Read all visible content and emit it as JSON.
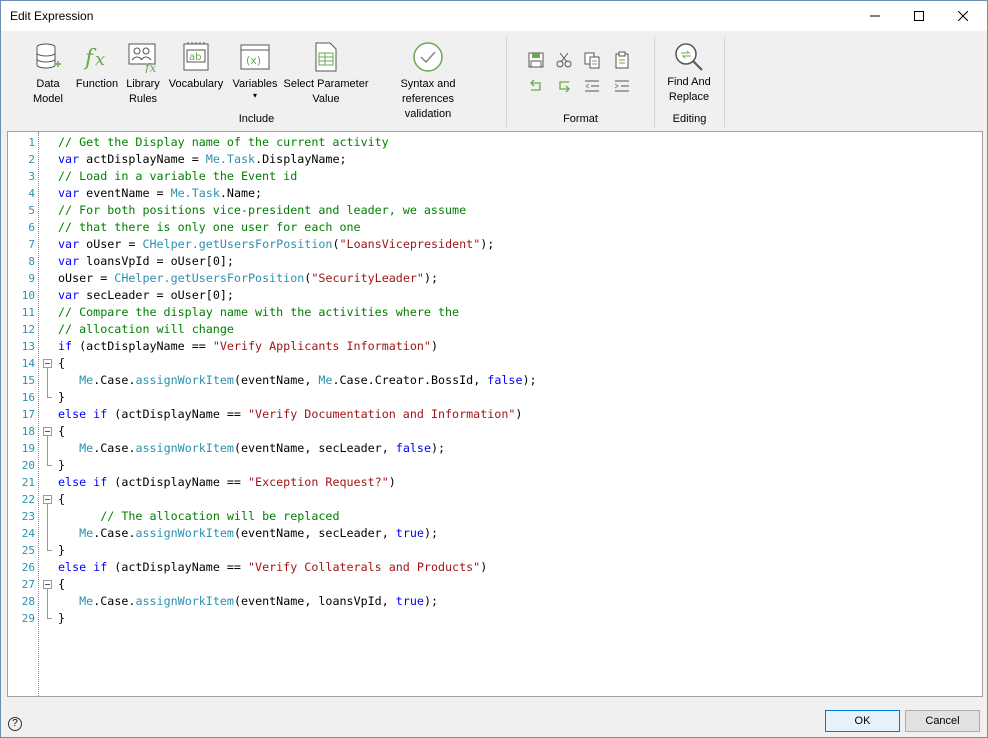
{
  "window": {
    "title": "Edit Expression",
    "controls": [
      "minimize",
      "maximize",
      "close"
    ]
  },
  "ribbon": {
    "include_group": {
      "label": "Include",
      "buttons": [
        {
          "id": "data-model",
          "label": "Data\nModel",
          "icon": "database-add-icon"
        },
        {
          "id": "function",
          "label": "Function",
          "icon": "fx-icon"
        },
        {
          "id": "library-rules",
          "label": "Library\nRules",
          "icon": "people-fx-icon"
        },
        {
          "id": "vocabulary",
          "label": "Vocabulary",
          "icon": "ab-notebook-icon"
        },
        {
          "id": "variables",
          "label": "Variables",
          "icon": "variable-x-icon"
        },
        {
          "id": "select-parameter-value",
          "label": "Select Parameter\nValue",
          "icon": "table-doc-icon"
        },
        {
          "id": "syntax-validation",
          "label": "Syntax and references\nvalidation",
          "icon": "check-circle-icon"
        }
      ]
    },
    "format_group": {
      "label": "Format",
      "icons": [
        "save-icon",
        "cut-icon",
        "copy-icon",
        "paste-icon",
        "undo-icon",
        "redo-icon",
        "outdent-icon",
        "indent-icon"
      ]
    },
    "editing_group": {
      "label": "Editing",
      "buttons": [
        {
          "id": "find-replace",
          "label": "Find And\nReplace",
          "icon": "magnifier-replace-icon"
        }
      ]
    }
  },
  "editor": {
    "lines": [
      [
        [
          "com",
          "// Get the Display name of the current activity"
        ]
      ],
      [
        [
          "kw",
          "var"
        ],
        [
          "pl",
          " actDisplayName = "
        ],
        [
          "obj",
          "Me.Task"
        ],
        [
          "pl",
          ".DisplayName;"
        ]
      ],
      [
        [
          "com",
          "// Load in a variable the Event id"
        ]
      ],
      [
        [
          "kw",
          "var"
        ],
        [
          "pl",
          " eventName = "
        ],
        [
          "obj",
          "Me.Task"
        ],
        [
          "pl",
          ".Name;"
        ]
      ],
      [
        [
          "com",
          "// For both positions vice-president and leader, we assume"
        ]
      ],
      [
        [
          "com",
          "// that there is only one user for each one"
        ]
      ],
      [
        [
          "kw",
          "var"
        ],
        [
          "pl",
          " oUser = "
        ],
        [
          "obj",
          "CHelper.getUsersForPosition"
        ],
        [
          "pl",
          "("
        ],
        [
          "str",
          "\"LoansVicepresident\""
        ],
        [
          "pl",
          ");"
        ]
      ],
      [
        [
          "kw",
          "var"
        ],
        [
          "pl",
          " loansVpId = oUser["
        ],
        [
          "num",
          "0"
        ],
        [
          "pl",
          "];"
        ]
      ],
      [
        [
          "pl",
          "oUser = "
        ],
        [
          "obj",
          "CHelper.getUsersForPosition"
        ],
        [
          "pl",
          "("
        ],
        [
          "str",
          "\"SecurityLeader\""
        ],
        [
          "pl",
          ");"
        ]
      ],
      [
        [
          "kw",
          "var"
        ],
        [
          "pl",
          " secLeader = oUser["
        ],
        [
          "num",
          "0"
        ],
        [
          "pl",
          "];"
        ]
      ],
      [
        [
          "com",
          "// Compare the display name with the activities where the"
        ]
      ],
      [
        [
          "com",
          "// allocation will change"
        ]
      ],
      [
        [
          "kw",
          "if"
        ],
        [
          "pl",
          " (actDisplayName == "
        ],
        [
          "str",
          "\"Verify Applicants Information\""
        ],
        [
          "pl",
          ")"
        ]
      ],
      [
        [
          "pl",
          "{"
        ]
      ],
      [
        [
          "pl",
          "   "
        ],
        [
          "obj",
          "Me"
        ],
        [
          "pl",
          ".Case."
        ],
        [
          "fn",
          "assignWorkItem"
        ],
        [
          "pl",
          "(eventName, "
        ],
        [
          "obj",
          "Me"
        ],
        [
          "pl",
          ".Case.Creator.BossId, "
        ],
        [
          "kw",
          "false"
        ],
        [
          "pl",
          ");"
        ]
      ],
      [
        [
          "pl",
          "}"
        ]
      ],
      [
        [
          "kw",
          "else if"
        ],
        [
          "pl",
          " (actDisplayName == "
        ],
        [
          "str",
          "\"Verify Documentation and Information\""
        ],
        [
          "pl",
          ")"
        ]
      ],
      [
        [
          "pl",
          "{"
        ]
      ],
      [
        [
          "pl",
          "   "
        ],
        [
          "obj",
          "Me"
        ],
        [
          "pl",
          ".Case."
        ],
        [
          "fn",
          "assignWorkItem"
        ],
        [
          "pl",
          "(eventName, secLeader, "
        ],
        [
          "kw",
          "false"
        ],
        [
          "pl",
          ");"
        ]
      ],
      [
        [
          "pl",
          "}"
        ]
      ],
      [
        [
          "kw",
          "else if"
        ],
        [
          "pl",
          " (actDisplayName == "
        ],
        [
          "str",
          "\"Exception Request?\""
        ],
        [
          "pl",
          ")"
        ]
      ],
      [
        [
          "pl",
          "{"
        ]
      ],
      [
        [
          "pl",
          "      "
        ],
        [
          "com",
          "// The allocation will be replaced"
        ]
      ],
      [
        [
          "pl",
          "   "
        ],
        [
          "obj",
          "Me"
        ],
        [
          "pl",
          ".Case."
        ],
        [
          "fn",
          "assignWorkItem"
        ],
        [
          "pl",
          "(eventName, secLeader, "
        ],
        [
          "kw",
          "true"
        ],
        [
          "pl",
          ");"
        ]
      ],
      [
        [
          "pl",
          "}"
        ]
      ],
      [
        [
          "kw",
          "else if"
        ],
        [
          "pl",
          " (actDisplayName == "
        ],
        [
          "str",
          "\"Verify Collaterals and Products\""
        ],
        [
          "pl",
          ")"
        ]
      ],
      [
        [
          "pl",
          "{"
        ]
      ],
      [
        [
          "pl",
          "   "
        ],
        [
          "obj",
          "Me"
        ],
        [
          "pl",
          ".Case."
        ],
        [
          "fn",
          "assignWorkItem"
        ],
        [
          "pl",
          "(eventName, loansVpId, "
        ],
        [
          "kw",
          "true"
        ],
        [
          "pl",
          ");"
        ]
      ],
      [
        [
          "pl",
          "}"
        ]
      ]
    ],
    "fold_open_lines": [
      14,
      18,
      22,
      27
    ],
    "fold_close_lines": [
      16,
      20,
      25,
      29
    ]
  },
  "footer": {
    "help_label": "?",
    "ok_label": "OK",
    "cancel_label": "Cancel"
  }
}
